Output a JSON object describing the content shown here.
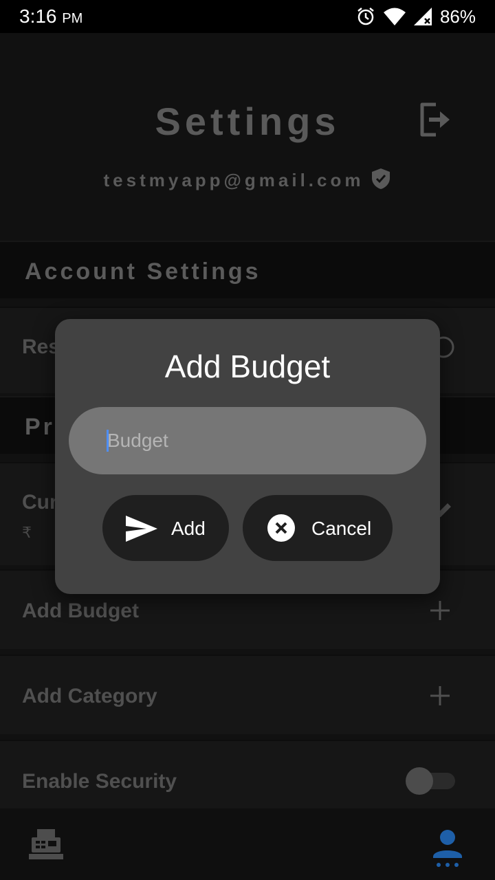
{
  "status_bar": {
    "time": "3:16",
    "ampm": "PM",
    "battery": "86%",
    "icons": [
      "alarm-icon",
      "wifi-icon",
      "signal-icon"
    ]
  },
  "page": {
    "title": "Settings",
    "email": "testmyapp@gmail.com",
    "sections": {
      "account": "Account Settings",
      "preferences_partial": "Pr"
    },
    "rows": {
      "reset_partial": "Res",
      "currency_partial": "Cur",
      "currency_symbol": "₹",
      "add_budget": "Add Budget",
      "add_category": "Add Category",
      "enable_security": "Enable Security"
    },
    "enable_security_on": false
  },
  "dialog": {
    "title": "Add Budget",
    "input_placeholder": "Budget",
    "input_value": "",
    "add_label": "Add",
    "cancel_label": "Cancel"
  },
  "bottom_nav": {
    "items": [
      "cash-register-icon",
      "person-icon"
    ],
    "active": "person-icon"
  },
  "colors": {
    "dialog_bg": "#424242",
    "input_bg": "#767676",
    "button_bg": "#1f1f1f",
    "active_nav": "#1e5fa8",
    "caret": "#4f8ff7"
  }
}
